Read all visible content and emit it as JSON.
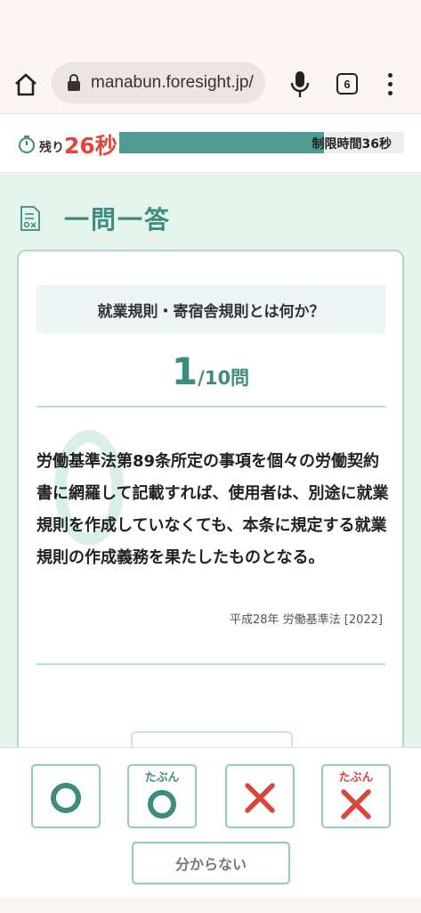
{
  "browser": {
    "url": "manabun.foresight.jp/",
    "tab_count": "6"
  },
  "timer": {
    "remain_label": "残り",
    "remain_value": "26秒",
    "limit_text": "制限時間36秒",
    "remaining_fraction": 0.72
  },
  "page": {
    "title": "一問一答"
  },
  "quiz": {
    "topic": "就業規則・寄宿舎規則とは何か？",
    "current": "1",
    "total": "/10問",
    "question": "労働基準法第89条所定の事項を個々の労働契約書に網羅して記載すれば、使用者は、別途に就業規則を作成していなくても、本条に規定する就業規則の作成義務を果たしたものとなる。",
    "source": "平成28年 労働基準法 [2022]"
  },
  "answers": {
    "maybe_label": "たぶん",
    "unknown_label": "分からない"
  },
  "colors": {
    "accent": "#3c8c80",
    "progress": "#4e9d90",
    "alert": "#e0463b",
    "wrong": "#d9463c"
  }
}
